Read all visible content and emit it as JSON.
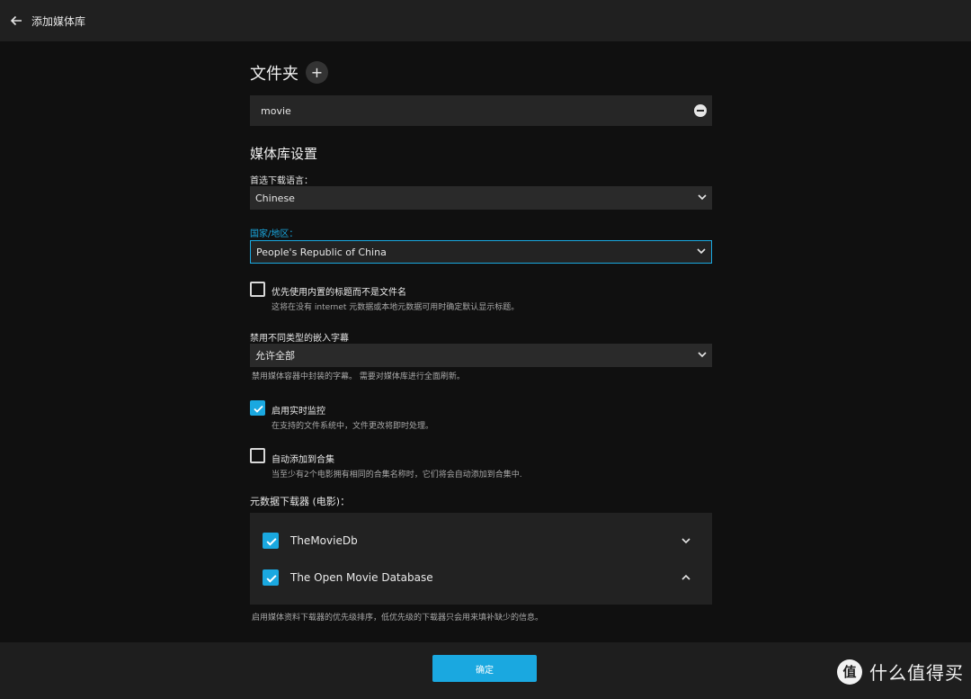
{
  "header": {
    "title": "添加媒体库",
    "back_icon": "arrow-left-icon"
  },
  "folders": {
    "heading": "文件夹",
    "add_label": "+",
    "items": [
      {
        "path": "movie"
      }
    ]
  },
  "settings": {
    "title": "媒体库设置",
    "language": {
      "label": "首选下载语言：",
      "value": "Chinese"
    },
    "country": {
      "label": "国家/地区：",
      "value": "People's Republic of China"
    },
    "embedded_titles": {
      "label": "优先使用内置的标题而不是文件名",
      "description": "这将在没有 internet 元数据或本地元数据可用时确定默认显示标题。",
      "checked": false
    },
    "subtitles": {
      "label": "禁用不同类型的嵌入字幕",
      "value": "允许全部",
      "help": "禁用媒体容器中封装的字幕。 需要对媒体库进行全面刷新。"
    },
    "realtime": {
      "label": "启用实时监控",
      "description": "在支持的文件系统中，文件更改将即时处理。",
      "checked": true
    },
    "auto_collection": {
      "label": "自动添加到合集",
      "description": "当至少有2个电影拥有相同的合集名称时，它们将会自动添加到合集中.",
      "checked": false
    },
    "metadata_fetchers": {
      "label": "元数据下载器 (电影)：",
      "items": [
        {
          "name": "TheMovieDb",
          "checked": true,
          "chevron": "chevron-down"
        },
        {
          "name": "The Open Movie Database",
          "checked": true,
          "chevron": "chevron-up"
        }
      ],
      "help": "启用媒体资料下载器的优先级排序，低优先级的下载器只会用来填补缺少的信息。"
    }
  },
  "footer": {
    "ok_label": "确定"
  },
  "watermark": {
    "logo_char": "值",
    "text": "什么值得买"
  },
  "colors": {
    "accent": "#1aa8e0",
    "background": "#101010",
    "panel": "#202020"
  }
}
